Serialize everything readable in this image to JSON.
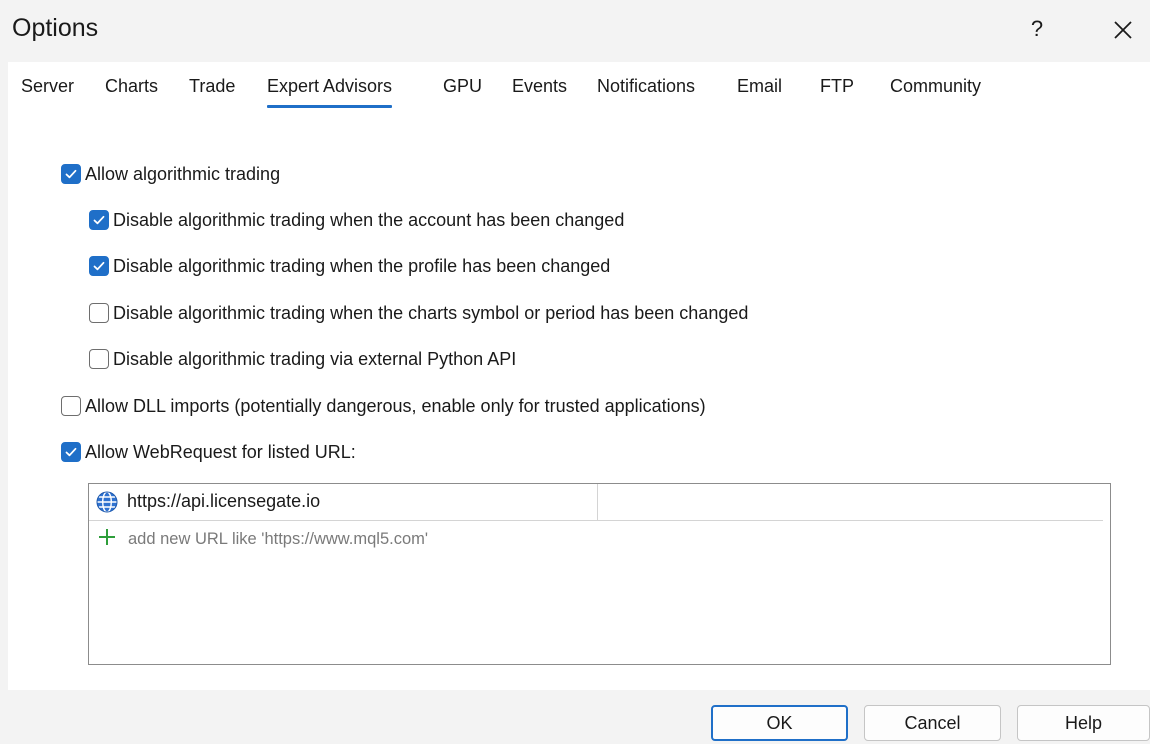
{
  "window": {
    "title": "Options",
    "help_glyph": "?",
    "close_icon": "close-icon"
  },
  "tabs": [
    {
      "label": "Server",
      "active": false
    },
    {
      "label": "Charts",
      "active": false
    },
    {
      "label": "Trade",
      "active": false
    },
    {
      "label": "Expert Advisors",
      "active": true
    },
    {
      "label": "GPU",
      "active": false
    },
    {
      "label": "Events",
      "active": false
    },
    {
      "label": "Notifications",
      "active": false
    },
    {
      "label": "Email",
      "active": false
    },
    {
      "label": "FTP",
      "active": false
    },
    {
      "label": "Community",
      "active": false
    }
  ],
  "options": {
    "allow_algo": {
      "label": "Allow algorithmic trading",
      "checked": true
    },
    "disable_account": {
      "label": "Disable algorithmic trading when the account has been changed",
      "checked": true
    },
    "disable_profile": {
      "label": "Disable algorithmic trading when the profile has been changed",
      "checked": true
    },
    "disable_symbol": {
      "label": "Disable algorithmic trading when the charts symbol or period has been changed",
      "checked": false
    },
    "disable_python": {
      "label": "Disable algorithmic trading via external Python API",
      "checked": false
    },
    "allow_dll": {
      "label": "Allow DLL imports (potentially dangerous, enable only for trusted applications)",
      "checked": false
    },
    "allow_webrequest": {
      "label": "Allow WebRequest for listed URL:",
      "checked": true
    }
  },
  "url_list": {
    "urls": [
      "https://api.licensegate.io"
    ],
    "add_placeholder": "add new URL like 'https://www.mql5.com'"
  },
  "buttons": {
    "ok": "OK",
    "cancel": "Cancel",
    "help": "Help"
  },
  "colors": {
    "accent": "#1f6fc8",
    "add_icon": "#2e9e3a"
  }
}
